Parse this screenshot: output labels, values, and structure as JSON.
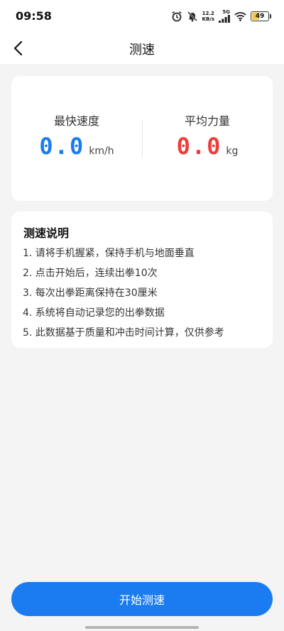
{
  "status_bar": {
    "time": "09:58",
    "net_speed_value": "12.2",
    "net_speed_unit": "KB/s",
    "network_type": "5G",
    "battery_level": "49",
    "icons": [
      "alarm-icon",
      "mute-bell-icon",
      "signal-icon",
      "wifi-icon",
      "battery-icon"
    ]
  },
  "header": {
    "title": "测速",
    "back_icon": "chevron-left-icon"
  },
  "stats": {
    "max_speed": {
      "label": "最快速度",
      "value": "0.0",
      "unit": "km/h",
      "color": "#1a7cf0"
    },
    "avg_force": {
      "label": "平均力量",
      "value": "0.0",
      "unit": "kg",
      "color": "#f03c3c"
    }
  },
  "instructions": {
    "title": "测速说明",
    "items": [
      "1. 请将手机握紧，保持手机与地面垂直",
      "2. 点击开始后，连续出拳10次",
      "3. 每次出拳距离保持在30厘米",
      "4. 系统将自动记录您的出拳数据",
      "5. 此数据基于质量和冲击时间计算，仅供参考"
    ]
  },
  "actions": {
    "start_label": "开始测速",
    "primary_color": "#1a7cf0"
  }
}
